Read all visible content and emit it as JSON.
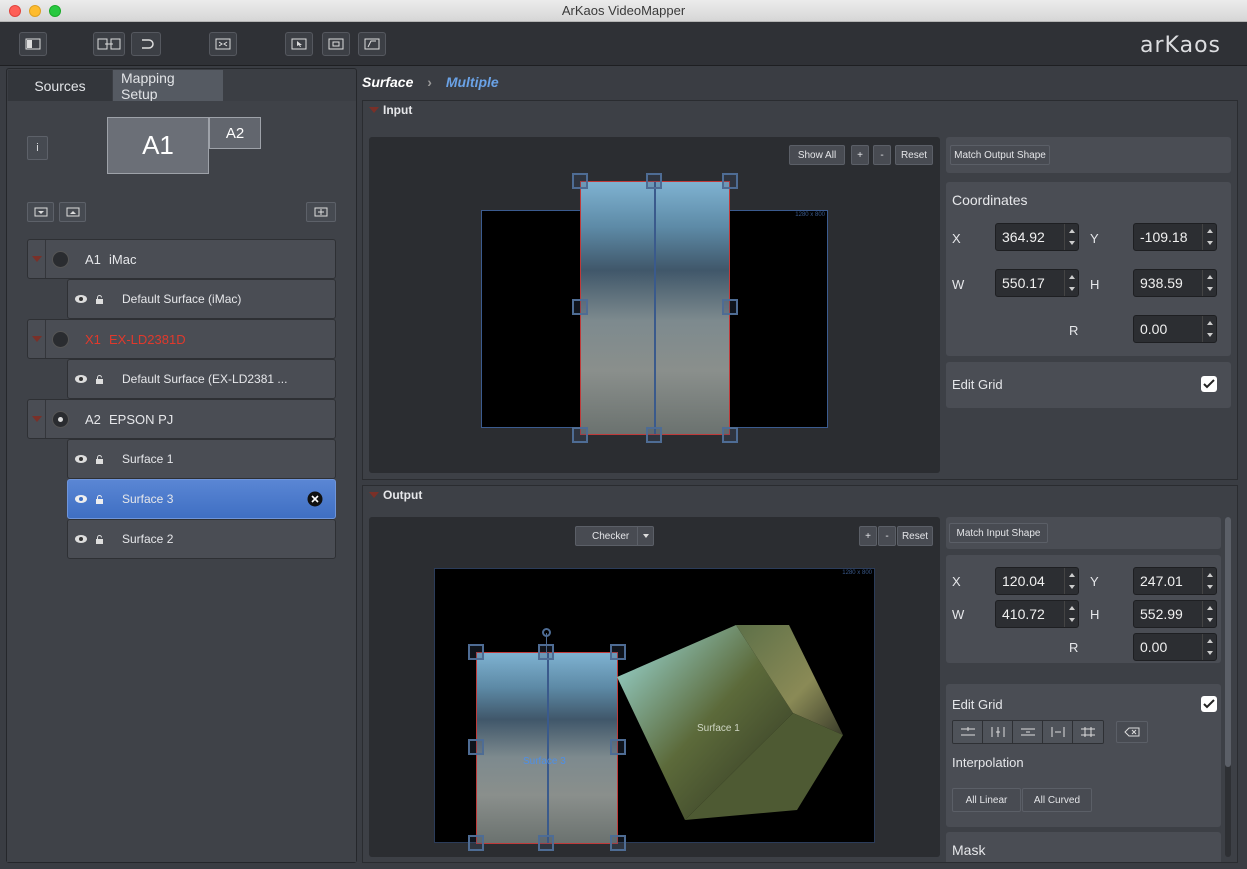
{
  "window": {
    "title": "ArKaos VideoMapper"
  },
  "toolbar": {
    "logo": "arKaos"
  },
  "left": {
    "tabs": [
      "Sources",
      "Mapping Setup"
    ],
    "info_label": "i",
    "screens": {
      "a1": "A1",
      "a2": "A2"
    },
    "groups": [
      {
        "id": "A1",
        "name": "iMac",
        "color": "#e6e7ea",
        "selected_dot": false,
        "children": [
          {
            "label": "Default Surface (iMac)"
          }
        ]
      },
      {
        "id": "X1",
        "name": "EX-LD2381D",
        "color": "#e0392c",
        "selected_dot": false,
        "children": [
          {
            "label": "Default Surface (EX-LD2381 ..."
          }
        ]
      },
      {
        "id": "A2",
        "name": "EPSON PJ",
        "color": "#e6e7ea",
        "selected_dot": true,
        "children": [
          {
            "label": "Surface 1"
          },
          {
            "label": "Surface 3",
            "selected": true
          },
          {
            "label": "Surface 2"
          }
        ]
      }
    ]
  },
  "breadcrumb": {
    "root": "Surface",
    "current": "Multiple"
  },
  "input": {
    "title": "Input",
    "show_all": "Show All",
    "plus": "+",
    "minus": "-",
    "reset": "Reset",
    "resolution": "1280 x 800",
    "match_button": "Match Output Shape",
    "coordinates_title": "Coordinates",
    "x_label": "X",
    "x": "364.92",
    "y_label": "Y",
    "y": "-109.18",
    "w_label": "W",
    "w": "550.17",
    "h_label": "H",
    "h": "938.59",
    "r_label": "R",
    "r": "0.00",
    "edit_grid": "Edit Grid",
    "edit_grid_checked": true
  },
  "output": {
    "title": "Output",
    "background_select": "Checker",
    "plus": "+",
    "minus": "-",
    "reset": "Reset",
    "resolution": "1280 x 800",
    "match_button": "Match Input Shape",
    "x_label": "X",
    "x": "120.04",
    "y_label": "Y",
    "y": "247.01",
    "w_label": "W",
    "w": "410.72",
    "h_label": "H",
    "h": "552.99",
    "r_label": "R",
    "r": "0.00",
    "edit_grid": "Edit Grid",
    "edit_grid_checked": true,
    "interpolation": "Interpolation",
    "all_linear": "All Linear",
    "all_curved": "All Curved",
    "mask": "Mask",
    "surface3_label": "Surface 3",
    "surface1_label": "Surface 1"
  }
}
